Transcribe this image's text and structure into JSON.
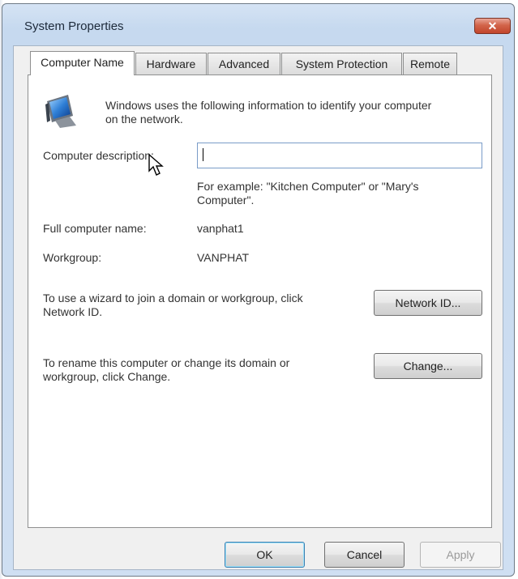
{
  "window": {
    "title": "System Properties",
    "close_label": "x"
  },
  "tabs": [
    {
      "label": "Computer Name",
      "active": true
    },
    {
      "label": "Hardware",
      "active": false
    },
    {
      "label": "Advanced",
      "active": false
    },
    {
      "label": "System Protection",
      "active": false
    },
    {
      "label": "Remote",
      "active": false
    }
  ],
  "panel": {
    "intro_line1": "Windows uses the following information to identify your computer",
    "intro_line2": "on the network.",
    "description_label": "Computer description:",
    "description_value": "",
    "example_line1": "For example: \"Kitchen Computer\" or \"Mary's",
    "example_line2": "Computer\".",
    "full_name_label": "Full computer name:",
    "full_name_value": "vanphat1",
    "workgroup_label": "Workgroup:",
    "workgroup_value": "VANPHAT",
    "network_id_text_line1": "To use a wizard to join a domain or workgroup, click",
    "network_id_text_line2": "Network ID.",
    "network_id_button": "Network ID...",
    "rename_text_line1": "To rename this computer or change its domain or",
    "rename_text_line2": "workgroup, click Change.",
    "change_button": "Change..."
  },
  "footer": {
    "ok_label": "OK",
    "cancel_label": "Cancel",
    "apply_label": "Apply"
  },
  "icons": {
    "computer": "computer-monitor-icon",
    "cursor": "mouse-pointer-icon",
    "close": "close-icon"
  }
}
